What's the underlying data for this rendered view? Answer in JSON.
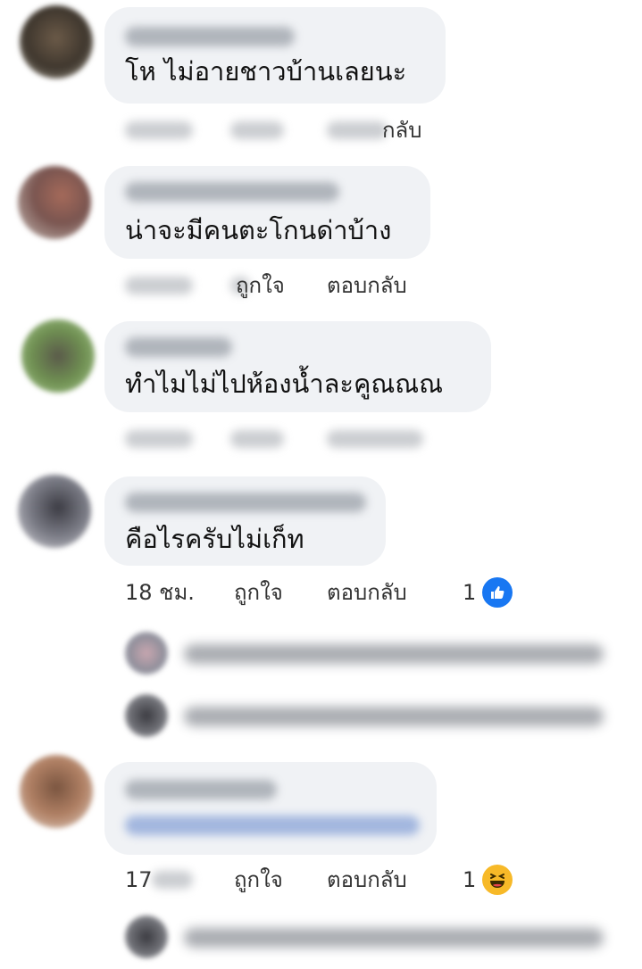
{
  "comments": [
    {
      "text": "โห ไม่อายชาวบ้านเลยนะ",
      "actions": {
        "reply": "กลับ"
      }
    },
    {
      "text": "น่าจะมีคนตะโกนด่าบ้าง",
      "actions": {
        "like": "ถูกใจ",
        "reply": "ตอบกลับ"
      }
    },
    {
      "text": "ทำไมไม่ไปห้องน้ำละคูณณณ",
      "actions": {}
    },
    {
      "text": "คือไรครับไม่เก็ท",
      "actions": {
        "time": "18 ชม.",
        "like": "ถูกใจ",
        "reply": "ตอบกลับ",
        "reaction_count": "1"
      },
      "reaction_icon": "like-icon",
      "reply_rows": 2
    },
    {
      "text": "",
      "actions": {
        "time": "17",
        "like": "ถูกใจ",
        "reply": "ตอบกลับ",
        "reaction_count": "1"
      },
      "reaction_icon": "laugh-icon",
      "reply_rows": 1
    }
  ],
  "colors": {
    "bubble": "#f0f2f5",
    "like_blue": "#1877f2",
    "haha_yellow": "#f7b928"
  }
}
